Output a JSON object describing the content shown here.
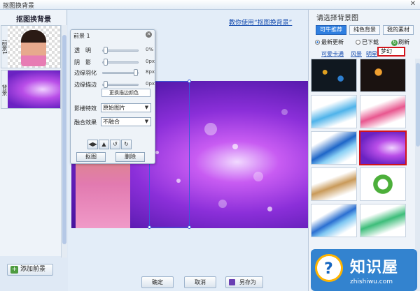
{
  "window": {
    "title": "抠图换背景",
    "close": "✕"
  },
  "left_panel": {
    "title": "抠图换背景",
    "layers": [
      {
        "label": "前景1"
      },
      {
        "label": "背景"
      }
    ],
    "add_button": "添加前景"
  },
  "tutorial_link": "教你使用“抠图换背景”",
  "dialog": {
    "header": "前景 1",
    "sliders": [
      {
        "label": "透　明",
        "value": "0%",
        "level": 0
      },
      {
        "label": "阴　影",
        "value": "0px",
        "level": 0
      },
      {
        "label": "边缘羽化",
        "value": "8px",
        "level": 0.9
      },
      {
        "label": "边缘描边",
        "value": "0px",
        "level": 0
      }
    ],
    "edge_color_button": "更换描边颜色",
    "effect_label": "影楼特效",
    "effect_value": "原始图片",
    "blend_label": "融合效果",
    "blend_value": "不融合",
    "pick_button": "抠图",
    "delete_button": "删除"
  },
  "bottom": {
    "ok": "确定",
    "cancel": "取消",
    "save_as": "另存为"
  },
  "right_panel": {
    "title": "请选择背景图",
    "tabs": [
      "可牛推荐",
      "纯色背景",
      "我的素材"
    ],
    "radios": [
      {
        "label": "最新更新",
        "checked": true
      },
      {
        "label": "已下载",
        "checked": false
      }
    ],
    "refresh": "刷新",
    "categories": [
      "可爱卡通",
      "风景",
      "明星"
    ],
    "selected_category": "梦幻"
  },
  "watermark": {
    "brand": "知识屋",
    "url": "zhishiwu.com"
  },
  "colors": {
    "accent": "#2f7fe0",
    "highlight_red": "#d2141b",
    "link": "#1a4fb0"
  }
}
